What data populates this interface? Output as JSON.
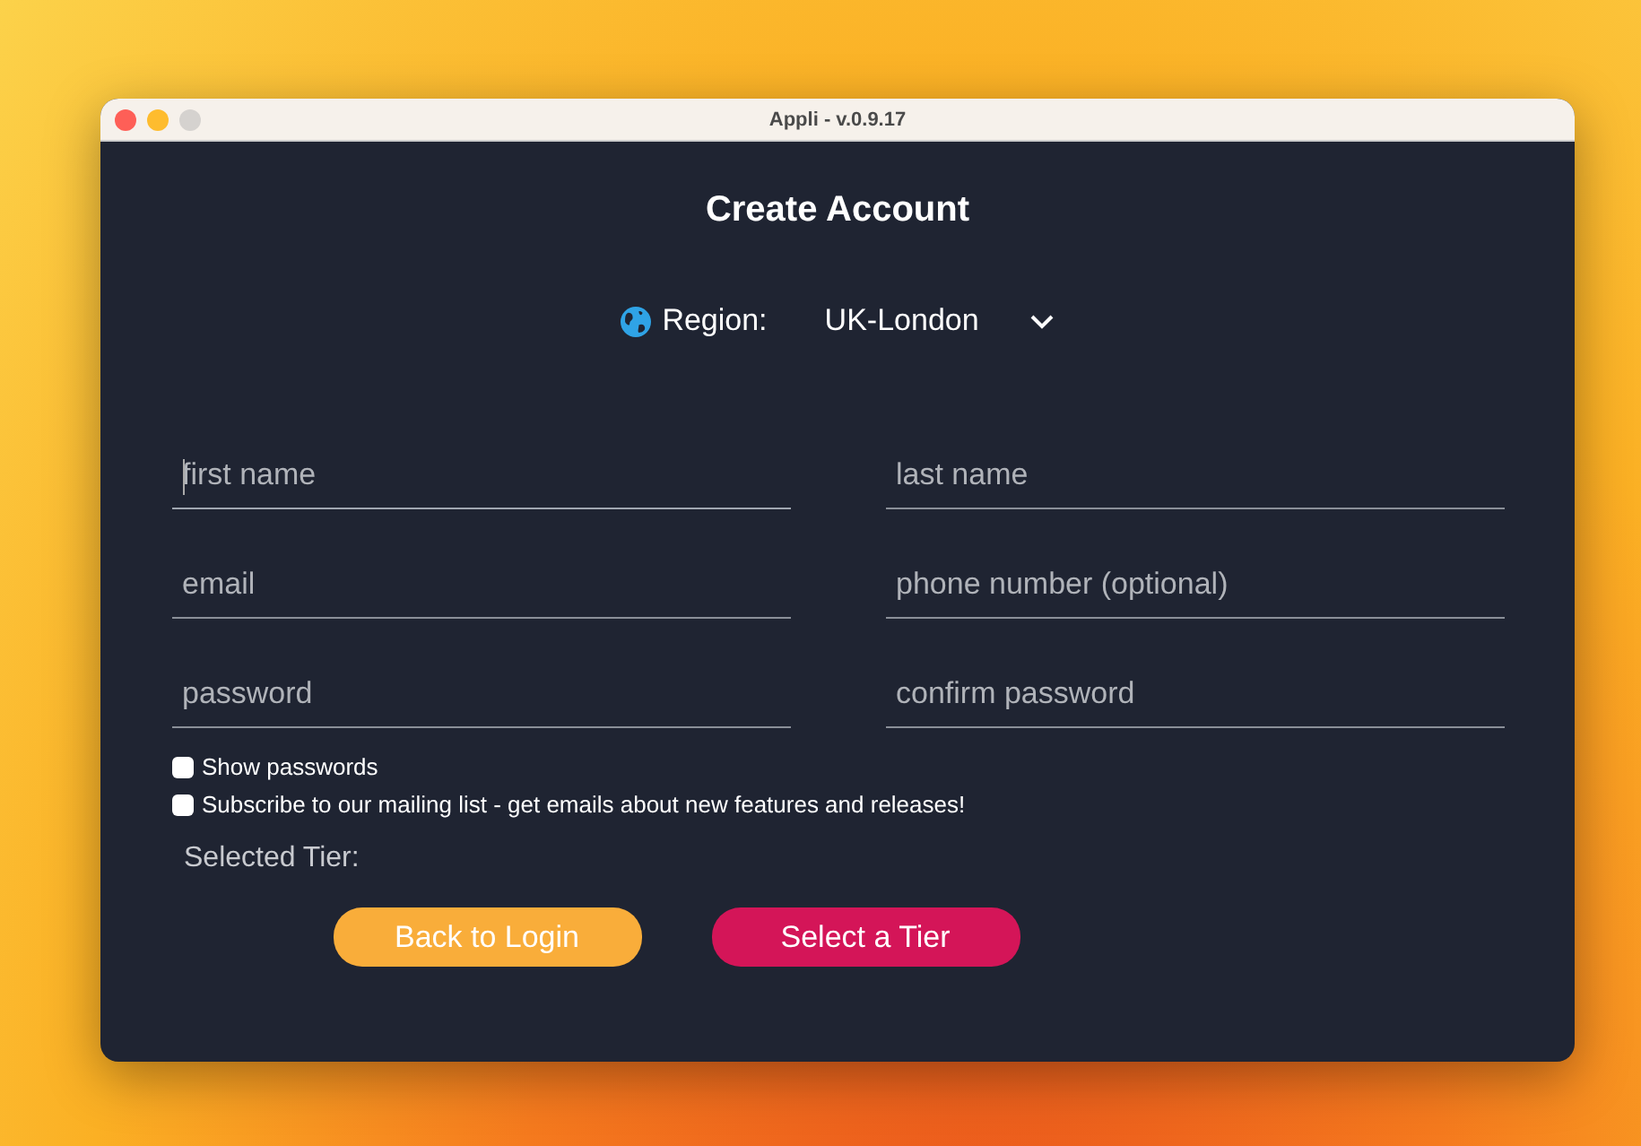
{
  "window": {
    "title": "Appli - v.0.9.17"
  },
  "heading": "Create Account",
  "region": {
    "label": "Region:",
    "value": "UK-London"
  },
  "fields": [
    {
      "placeholder": "first name",
      "focused": true
    },
    {
      "placeholder": "last name",
      "focused": false
    },
    {
      "placeholder": "email",
      "focused": false
    },
    {
      "placeholder": "phone number (optional)",
      "focused": false
    },
    {
      "placeholder": "password",
      "focused": false
    },
    {
      "placeholder": "confirm password",
      "focused": false
    }
  ],
  "options": [
    {
      "label": "Show passwords",
      "checked": false
    },
    {
      "label": "Subscribe to our mailing list - get emails about new features and releases!",
      "checked": false
    }
  ],
  "selected_tier": {
    "label": "Selected Tier:"
  },
  "buttons": [
    {
      "label": "Back to Login",
      "kind": "secondary"
    },
    {
      "label": "Select a Tier",
      "kind": "primary"
    }
  ]
}
